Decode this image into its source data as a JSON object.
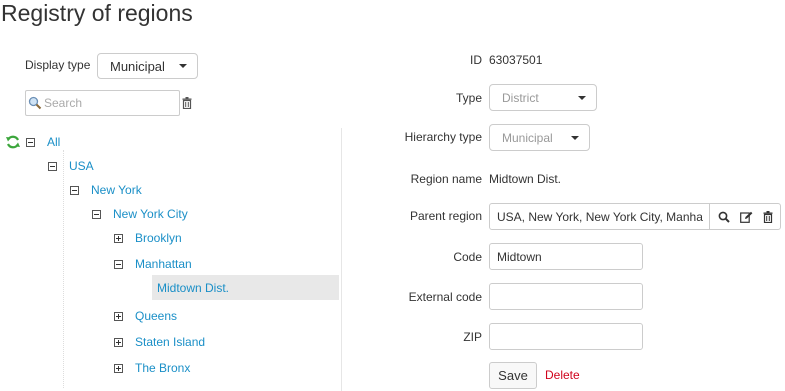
{
  "page": {
    "title": "Registry of regions"
  },
  "left": {
    "display_type_label": "Display type",
    "display_type_value": "Municipal",
    "search_placeholder": "Search",
    "tree": [
      {
        "label": "All",
        "level": 0,
        "state": "expanded"
      },
      {
        "label": "USA",
        "level": 1,
        "state": "expanded"
      },
      {
        "label": "New York",
        "level": 2,
        "state": "expanded"
      },
      {
        "label": "New York City",
        "level": 3,
        "state": "expanded"
      },
      {
        "label": "Brooklyn",
        "level": 4,
        "state": "collapsed"
      },
      {
        "label": "Manhattan",
        "level": 4,
        "state": "expanded"
      },
      {
        "label": "Midtown Dist.",
        "level": 5,
        "state": "leaf",
        "selected": true
      },
      {
        "label": "Queens",
        "level": 4,
        "state": "collapsed"
      },
      {
        "label": "Staten Island",
        "level": 4,
        "state": "collapsed"
      },
      {
        "label": "The Bronx",
        "level": 4,
        "state": "collapsed"
      }
    ]
  },
  "form": {
    "id_label": "ID",
    "id_value": "63037501",
    "type_label": "Type",
    "type_value": "District",
    "hierarchy_label": "Hierarchy type",
    "hierarchy_value": "Municipal",
    "region_name_label": "Region name",
    "region_name_value": "Midtown Dist.",
    "parent_label": "Parent region",
    "parent_value": "USA, New York, New York City, Manha",
    "code_label": "Code",
    "code_value": "Midtown",
    "external_code_label": "External code",
    "external_code_value": "",
    "zip_label": "ZIP",
    "zip_value": "",
    "save_label": "Save",
    "delete_label": "Delete"
  },
  "colors": {
    "link": "#1a8fc7",
    "refresh": "#3ca63c",
    "delete": "#d0021b",
    "selected_bg": "#e8e8e8"
  },
  "icons": {
    "refresh": "refresh-icon",
    "search": "search-icon",
    "trash": "trash-icon",
    "edit": "edit-icon",
    "magnifier": "magnifier-icon"
  }
}
